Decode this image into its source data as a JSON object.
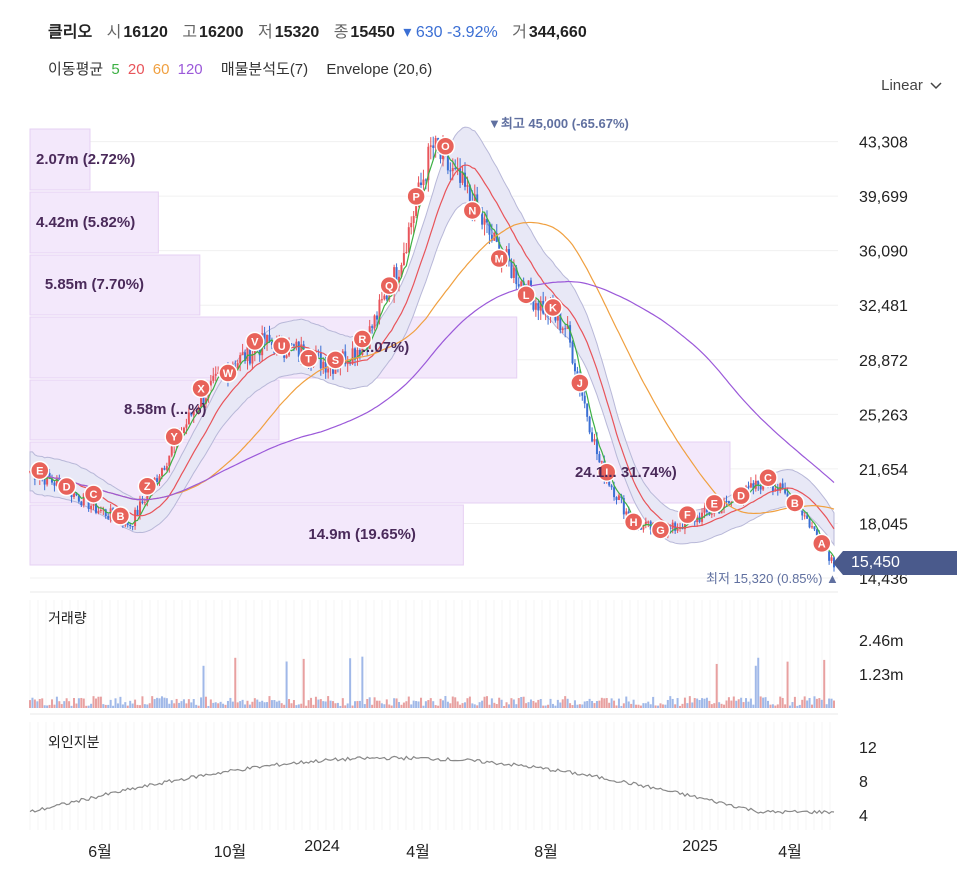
{
  "header": {
    "name": "클리오",
    "open_label": "시",
    "open": "16120",
    "high_label": "고",
    "high": "16200",
    "low_label": "저",
    "low": "15320",
    "close_label": "종",
    "close": "15450",
    "change": "▾ 630 -3.92%",
    "volume_label": "거",
    "volume": "344,660"
  },
  "indicators": {
    "ma_label": "이동평균",
    "ma5": "5",
    "ma20": "20",
    "ma60": "60",
    "ma120": "120",
    "analysis": "매물분석도(7)",
    "envelope": "Envelope (20,6)"
  },
  "scale_toggle": "Linear",
  "colors": {
    "up": "#e8545a",
    "down": "#3b6fd4",
    "ma5": "#3cb043",
    "ma20": "#e8545a",
    "ma60": "#f0a040",
    "ma120": "#9b59d9",
    "profile": "#efe2f8",
    "badge": "#e8625a",
    "last_price_bg": "#4a5a8c"
  },
  "price_axis": [
    "43,308",
    "39,699",
    "36,090",
    "32,481",
    "28,872",
    "25,263",
    "21,654",
    "18,045",
    "14,436"
  ],
  "last_price": "15,450",
  "max_annotation": "▼최고 45,000 (-65.67%)",
  "min_annotation": "최저 15,320 (0.85%) ▲",
  "volume_profile": [
    {
      "label": "2.07m (2.72%)",
      "share": 2.72
    },
    {
      "label": "4.42m (5.82%)",
      "share": 5.82
    },
    {
      "label": "5.85m (7.70%)",
      "share": 7.7
    },
    {
      "label": "...07%)",
      "share": 22.07
    },
    {
      "label": "8.58m (...%)",
      "share": 11.29
    },
    {
      "label": "24.1... 31.74%)",
      "share": 31.74
    },
    {
      "label": "14.9m (19.65%)",
      "share": 19.65
    }
  ],
  "badges": [
    "E",
    "D",
    "C",
    "B",
    "Z",
    "Y",
    "X",
    "W",
    "V",
    "U",
    "T",
    "S",
    "R",
    "Q",
    "P",
    "O",
    "N",
    "M",
    "L",
    "K",
    "J",
    "I",
    "H",
    "G",
    "F",
    "E",
    "D",
    "C",
    "B",
    "A"
  ],
  "volume_panel": {
    "title": "거래량",
    "axis": [
      "2.46m",
      "1.23m"
    ]
  },
  "foreign_panel": {
    "title": "외인지분",
    "axis": [
      "12",
      "8",
      "4"
    ]
  },
  "x_axis": [
    "6월",
    "10월",
    "2024",
    "4월",
    "8월",
    "2025",
    "4월"
  ],
  "chart_data": {
    "type": "candlestick",
    "ylim": [
      14436,
      45000
    ],
    "x": [
      "6월",
      "10월",
      "2024",
      "4월",
      "8월",
      "2025",
      "4월"
    ],
    "series": [
      {
        "name": "price_close_approx",
        "values": [
          21500,
          20500,
          19000,
          18000,
          22000,
          26000,
          28500,
          30000,
          29500,
          28500,
          30000,
          35000,
          43000,
          40000,
          36000,
          33000,
          31000,
          22000,
          18000,
          17500,
          18500,
          19500,
          21000,
          19000,
          15450
        ]
      }
    ]
  }
}
